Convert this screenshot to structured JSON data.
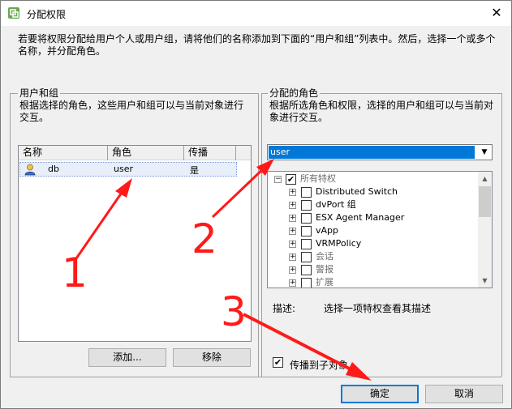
{
  "window": {
    "title": "分配权限",
    "close_glyph": "✕",
    "instructions": "若要将权限分配给用户个人或用户组，请将他们的名称添加到下面的“用户和组”列表中。然后，选择一个或多个名称，并分配角色。"
  },
  "users_groups": {
    "title": "用户和组",
    "description": "根据选择的角色，这些用户和组可以与当前对象进行交互。",
    "columns": [
      "名称",
      "角色",
      "传播"
    ],
    "rows": [
      {
        "name": "db",
        "role": "user",
        "propagate": "是",
        "icon": "user-icon"
      }
    ],
    "add_button": "添加...",
    "remove_button": "移除"
  },
  "assigned_role": {
    "title": "分配的角色",
    "description": "根据所选角色和权限，选择的用户和组可以与当前对象进行交互。",
    "selected_role": "user",
    "tree": {
      "root": {
        "label": "所有特权",
        "checked": true,
        "expanded": true
      },
      "items": [
        {
          "label": "Distributed Switch",
          "checked": false
        },
        {
          "label": "dvPort 组",
          "checked": false
        },
        {
          "label": "ESX Agent Manager",
          "checked": false
        },
        {
          "label": "vApp",
          "checked": false
        },
        {
          "label": "VRMPolicy",
          "checked": false
        },
        {
          "label": "会话",
          "checked": false
        },
        {
          "label": "警报",
          "checked": false
        },
        {
          "label": "扩展",
          "checked": false
        }
      ]
    },
    "desc_label": "描述:",
    "desc_text": "选择一项特权查看其描述",
    "propagate_label": "传播到子对象",
    "propagate_checked": true
  },
  "footer": {
    "ok_button": "确定",
    "cancel_button": "取消"
  },
  "annotations": {
    "color": "#ff1a1a",
    "labels": [
      "1",
      "2",
      "3"
    ]
  }
}
